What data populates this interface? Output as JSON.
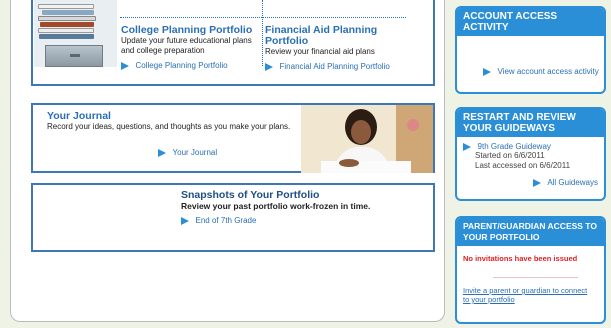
{
  "college": {
    "title": "College Planning Portfolio",
    "desc": "Update your future educational plans and college preparation",
    "link": "College Planning Portfolio"
  },
  "financial": {
    "title": "Financial Aid Planning Portfolio",
    "desc": "Review your financial aid plans",
    "link": "Financial Aid Planning Portfolio"
  },
  "journal": {
    "title": "Your Journal",
    "desc": "Record your ideas, questions, and thoughts as you make your plans.",
    "link": "Your Journal"
  },
  "snapshots": {
    "title": "Snapshots of Your Portfolio",
    "desc": "Review your past portfolio work-frozen in time.",
    "link": "End of 7th Grade"
  },
  "sidebar": {
    "access": {
      "heading": "ACCOUNT ACCESS ACTIVITY",
      "link": "View account access activity"
    },
    "guideways": {
      "heading": "RESTART AND REVIEW YOUR GUIDEWAYS",
      "item": "9th Grade Guideway",
      "started": "Started on 6/6/2011",
      "accessed": "Last accessed on 6/6/2011",
      "all_link": "All Guideways"
    },
    "parent": {
      "heading": "PARENT/GUARDIAN ACCESS TO YOUR PORTFOLIO",
      "status": "No invitations have been issued",
      "invite_link": "Invite a parent or guardian to connect to your portfolio"
    }
  },
  "colors": {
    "primary_blue": "#2a8fd6",
    "border_blue": "#3d77b8",
    "link_blue": "#2a6fb5",
    "alert_red": "#d22"
  },
  "icons": [
    "arrow-right-icon",
    "books-stack-image",
    "student-writing-image"
  ]
}
